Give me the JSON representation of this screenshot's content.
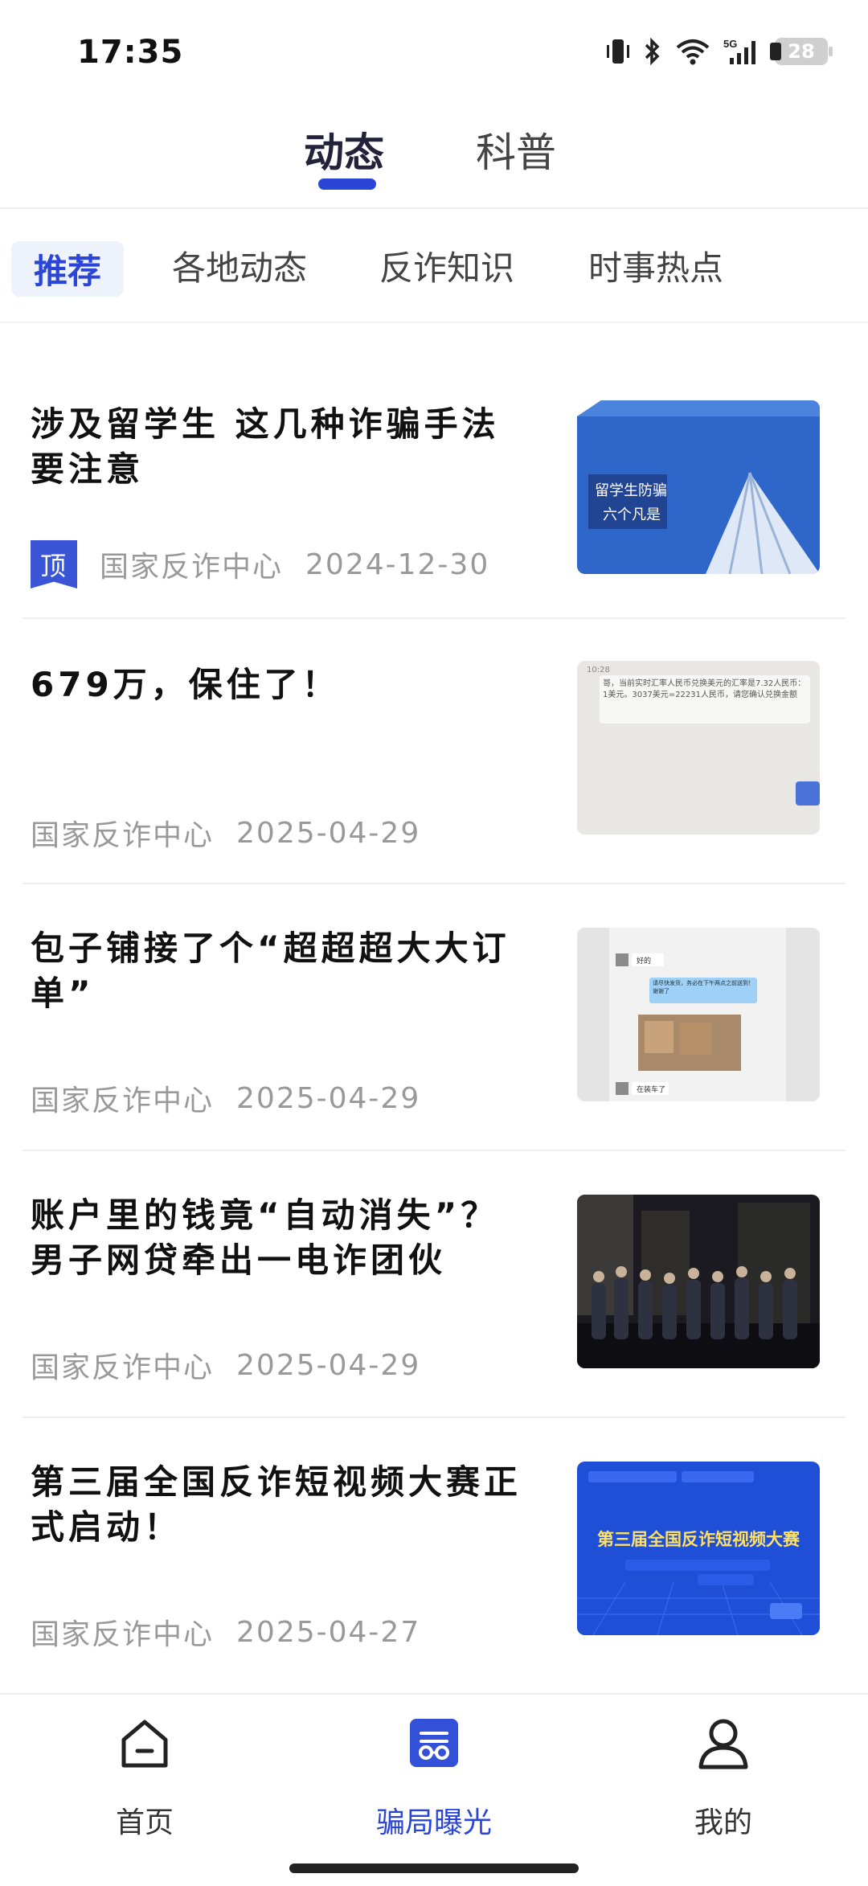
{
  "status_bar": {
    "time": "17:35",
    "battery_level": "28",
    "network": "5G"
  },
  "top_tabs": [
    {
      "label": "动态",
      "active": true
    },
    {
      "label": "科普",
      "active": false
    }
  ],
  "categories": [
    {
      "label": "推荐",
      "active": true
    },
    {
      "label": "各地动态",
      "active": false
    },
    {
      "label": "反诈知识",
      "active": false
    },
    {
      "label": "时事热点",
      "active": false
    }
  ],
  "articles": [
    {
      "title": "涉及留学生 这几种诈骗手法要注意",
      "pinned": true,
      "pin_label": "顶",
      "source": "国家反诈中心",
      "date": "2024-12-30",
      "thumb_text": [
        "留学生防骗",
        "六个凡是"
      ]
    },
    {
      "title": "679万，保住了！",
      "pinned": false,
      "source": "国家反诈中心",
      "date": "2025-04-29",
      "thumb_text": [
        "10:28",
        "哥，当前实时汇率人民币兑换美元的汇率是7.32人民币：1美元。3037美元=22231人民币，请您确认兑换金额"
      ]
    },
    {
      "title": "包子铺接了个“超超超大大订单”",
      "pinned": false,
      "source": "国家反诈中心",
      "date": "2025-04-29",
      "thumb_text": [
        "好的",
        "请尽快发货，务必在下午两点之前送到！谢谢了",
        "在装车了"
      ]
    },
    {
      "title": "账户里的钱竟“自动消失”？男子网贷牵出一电诈团伙",
      "pinned": false,
      "source": "国家反诈中心",
      "date": "2025-04-29"
    },
    {
      "title": "第三届全国反诈短视频大赛正式启动！",
      "pinned": false,
      "source": "国家反诈中心",
      "date": "2025-04-27",
      "thumb_text": [
        "第三届全国反诈短视频大赛"
      ]
    }
  ],
  "bottom_nav": [
    {
      "label": "首页",
      "icon": "home-icon",
      "active": false
    },
    {
      "label": "骗局曝光",
      "icon": "exposure-icon",
      "active": true
    },
    {
      "label": "我的",
      "icon": "profile-icon",
      "active": false
    }
  ],
  "colors": {
    "accent": "#2b46d6",
    "text_primary": "#111111",
    "text_secondary": "#999999",
    "divider": "#eeeeee"
  }
}
